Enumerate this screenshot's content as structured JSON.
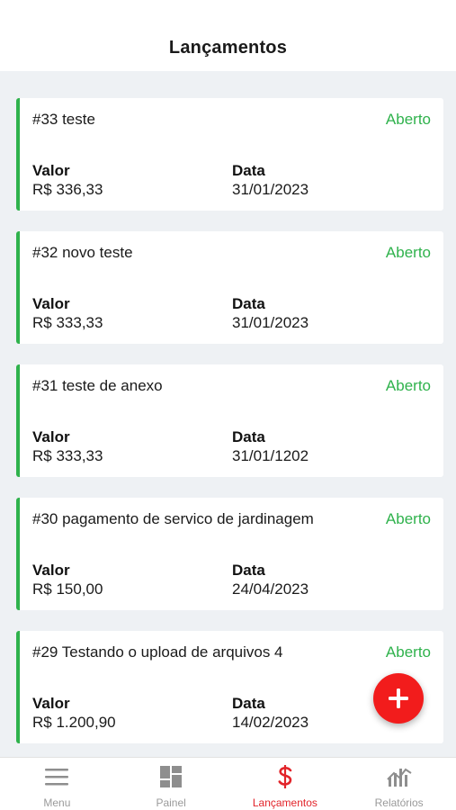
{
  "header": {
    "title": "Lançamentos"
  },
  "cards": [
    {
      "title": "#33 teste",
      "status": "Aberto",
      "value_label": "Valor",
      "value": "R$ 336,33",
      "date_label": "Data",
      "date": "31/01/2023"
    },
    {
      "title": "#32 novo teste",
      "status": "Aberto",
      "value_label": "Valor",
      "value": "R$ 333,33",
      "date_label": "Data",
      "date": "31/01/2023"
    },
    {
      "title": "#31 teste de anexo",
      "status": "Aberto",
      "value_label": "Valor",
      "value": "R$ 333,33",
      "date_label": "Data",
      "date": "31/01/1202"
    },
    {
      "title": "#30 pagamento de servico de jardinagem",
      "status": "Aberto",
      "value_label": "Valor",
      "value": "R$ 150,00",
      "date_label": "Data",
      "date": "24/04/2023"
    },
    {
      "title": "#29 Testando o upload de arquivos 4",
      "status": "Aberto",
      "value_label": "Valor",
      "value": "R$ 1.200,90",
      "date_label": "Data",
      "date": "14/02/2023"
    }
  ],
  "fab": {
    "icon": "plus-icon"
  },
  "tabbar": {
    "tabs": [
      {
        "label": "Menu",
        "icon": "menu-icon",
        "active": false
      },
      {
        "label": "Painel",
        "icon": "dashboard-icon",
        "active": false
      },
      {
        "label": "Lançamentos",
        "icon": "dollar-icon",
        "active": true
      },
      {
        "label": "Relatórios",
        "icon": "chart-icon",
        "active": false
      }
    ]
  },
  "colors": {
    "accent_green": "#2fb24c",
    "accent_red": "#e2242a",
    "fab_red": "#f21c1c",
    "background": "#eef1f4"
  }
}
